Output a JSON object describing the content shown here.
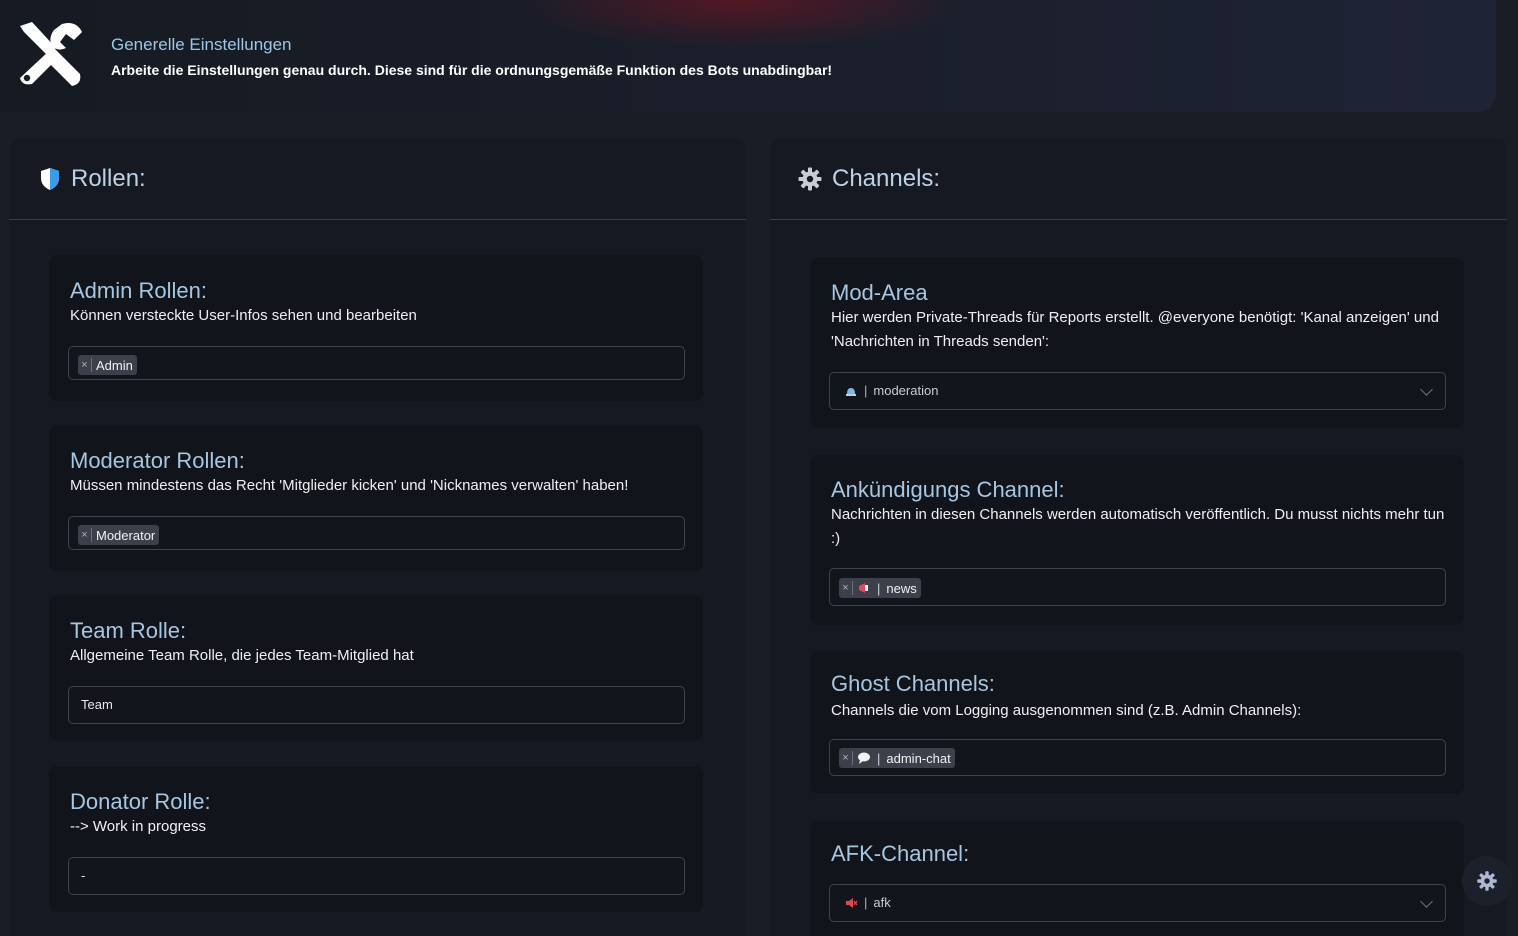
{
  "header": {
    "icon": "tools-icon",
    "title": "Generelle Einstellungen",
    "subtitle": "Arbeite die Einstellungen genau durch. Diese sind für die ordnungsgemäße Funktion des Bots unabdingbar!"
  },
  "roles": {
    "icon": "shield-icon",
    "title": "Rollen:",
    "cards": [
      {
        "title": "Admin Rollen:",
        "desc": "Können versteckte User-Infos sehen und bearbeiten",
        "tags": [
          "Admin"
        ]
      },
      {
        "title": "Moderator Rollen:",
        "desc": "Müssen mindestens das Recht 'Mitglieder kicken' und 'Nicknames verwalten' haben!",
        "tags": [
          "Moderator"
        ]
      },
      {
        "title": "Team Rolle:",
        "desc": "Allgemeine Team Rolle, die jedes Team-Mitglied hat",
        "value": "Team"
      },
      {
        "title": "Donator Rolle:",
        "desc": "--> Work in progress",
        "value": "-"
      }
    ]
  },
  "channels": {
    "icon": "gear-icon",
    "title": "Channels:",
    "cards": [
      {
        "title": "Mod-Area",
        "desc": "Hier werden Private-Threads für Reports erstellt. @everyone benötigt: 'Kanal anzeigen' und 'Nachrichten in Threads senden':",
        "select": {
          "emoji": "police-light-icon",
          "sep": "|",
          "value": "moderation"
        }
      },
      {
        "title": "Ankündigungs Channel:",
        "desc": "Nachrichten in diesen Channels werden automatisch veröffentlich. Du musst nichts mehr tun :)",
        "tag": {
          "emoji": "megaphone-icon",
          "sep": "|",
          "value": "news"
        }
      },
      {
        "title": "Ghost Channels:",
        "desc": "Channels die vom Logging ausgenommen sind (z.B. Admin Channels):",
        "tag": {
          "emoji": "speech-bubble-icon",
          "sep": "|",
          "value": "admin-chat"
        }
      },
      {
        "title": "AFK-Channel:",
        "select": {
          "emoji": "muted-speaker-icon",
          "sep": "|",
          "value": "afk"
        }
      }
    ]
  },
  "tag_remove_symbol": "×",
  "fab": {
    "icon": "settings-gear-icon"
  },
  "colors": {
    "accent_title": "#a6c6e2",
    "background": "#1a1d25",
    "card": "#11141a"
  }
}
